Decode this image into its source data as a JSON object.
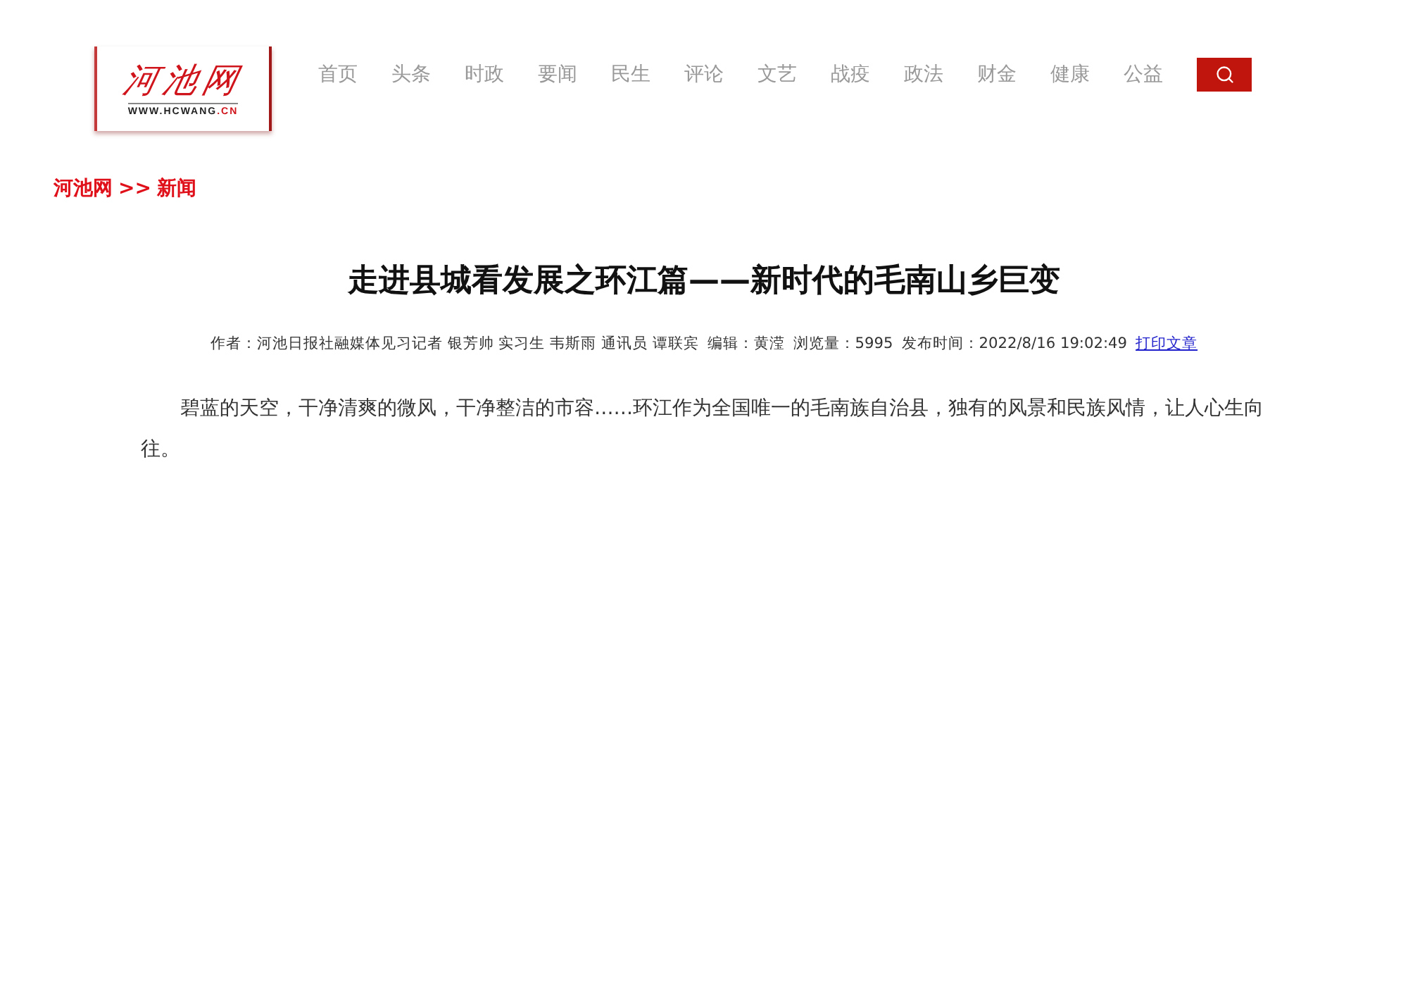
{
  "logo": {
    "mark": "河池网",
    "domain": "WWW.HCWANG",
    "tld": ".CN"
  },
  "nav": {
    "items": [
      "首页",
      "头条",
      "时政",
      "要闻",
      "民生",
      "评论",
      "文艺",
      "战疫",
      "政法",
      "财金",
      "健康",
      "公益"
    ]
  },
  "breadcrumb": {
    "items": [
      "河池网",
      "新闻"
    ],
    "separator": ">>"
  },
  "article": {
    "title": "走进县城看发展之环江篇——新时代的毛南山乡巨变",
    "meta": {
      "author": "作者：河池日报社融媒体见习记者 银芳帅 实习生 韦斯雨 通讯员 谭联宾",
      "editor": "编辑：黄滢",
      "views": "浏览量：5995",
      "published": "发布时间：2022/8/16 19:02:49",
      "print_link": "打印文章"
    },
    "paragraphs": [
      "碧蓝的天空，干净清爽的微风，干净整洁的市容……环江作为全国唯一的毛南族自治县，独有的风景和民族风情，让人心生向往。"
    ]
  }
}
